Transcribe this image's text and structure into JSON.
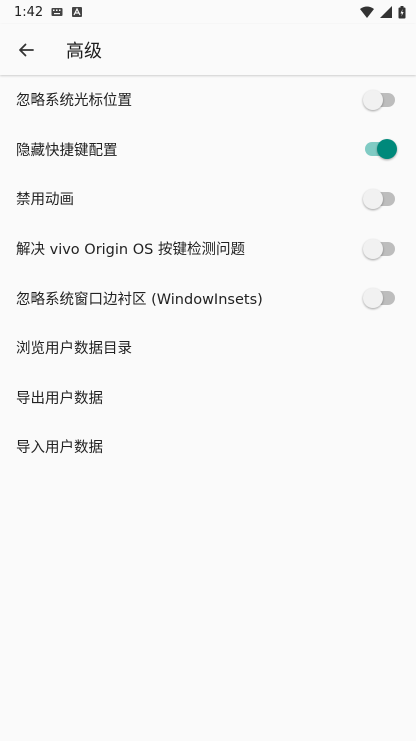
{
  "status_bar": {
    "time": "1:42"
  },
  "app_bar": {
    "title": "高级"
  },
  "settings": [
    {
      "label": "忽略系统光标位置",
      "toggle": false
    },
    {
      "label": "隐藏快捷键配置",
      "toggle": true
    },
    {
      "label": "禁用动画",
      "toggle": false
    },
    {
      "label": "解决 vivo Origin OS 按键检测问题",
      "toggle": false
    },
    {
      "label": "忽略系统窗口边衬区 (WindowInsets)",
      "toggle": false
    },
    {
      "label": "浏览用户数据目录"
    },
    {
      "label": "导出用户数据"
    },
    {
      "label": "导入用户数据"
    }
  ],
  "colors": {
    "accent": "#00897b",
    "accent_track": "#80cbc4",
    "off_track": "#bdbdbd"
  }
}
